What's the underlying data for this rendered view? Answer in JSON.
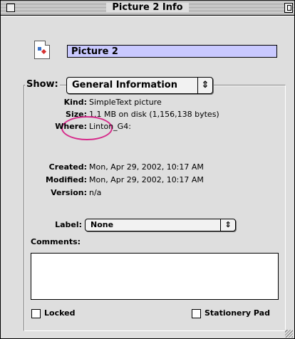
{
  "window": {
    "title": "Picture 2 Info"
  },
  "file": {
    "name": "Picture 2"
  },
  "show": {
    "label": "Show:",
    "value": "General Information"
  },
  "info": {
    "kind_label": "Kind:",
    "kind_value": "SimpleText picture",
    "size_label": "Size:",
    "size_value": "1.1 MB on disk (1,156,138 bytes)",
    "where_label": "Where:",
    "where_value": "Linton_G4:",
    "created_label": "Created:",
    "created_value": "Mon, Apr 29, 2002, 10:17 AM",
    "modified_label": "Modified:",
    "modified_value": "Mon, Apr 29, 2002, 10:17 AM",
    "version_label": "Version:",
    "version_value": "n/a"
  },
  "label_popup": {
    "label": "Label:",
    "value": "None"
  },
  "comments": {
    "label": "Comments:",
    "value": ""
  },
  "checkboxes": {
    "locked": "Locked",
    "stationery": "Stationery Pad"
  },
  "colors": {
    "name_highlight": "#c9c9ff",
    "annotation_circle": "#d62a8a"
  }
}
